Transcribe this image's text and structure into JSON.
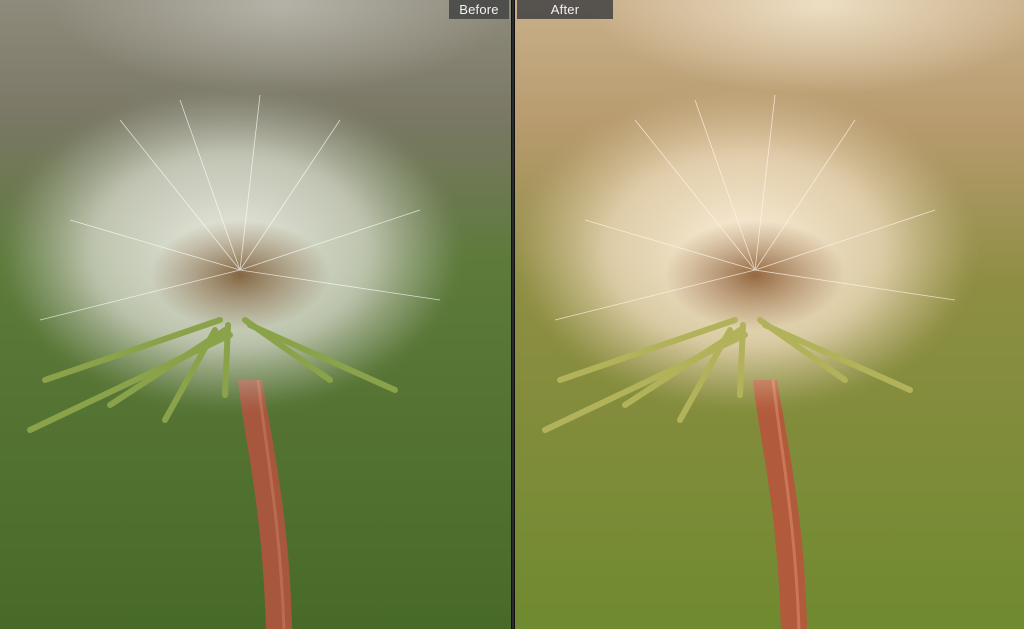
{
  "compare_view": {
    "before_label": "Before",
    "after_label": "After"
  },
  "colors": {
    "before_background_top": "#8d8a78",
    "before_background_bottom": "#4f6f2c",
    "after_background_top": "#cbb28c",
    "after_background_bottom": "#7f8a35",
    "stem": "#a6573e",
    "divider": "#2b2b2b"
  }
}
